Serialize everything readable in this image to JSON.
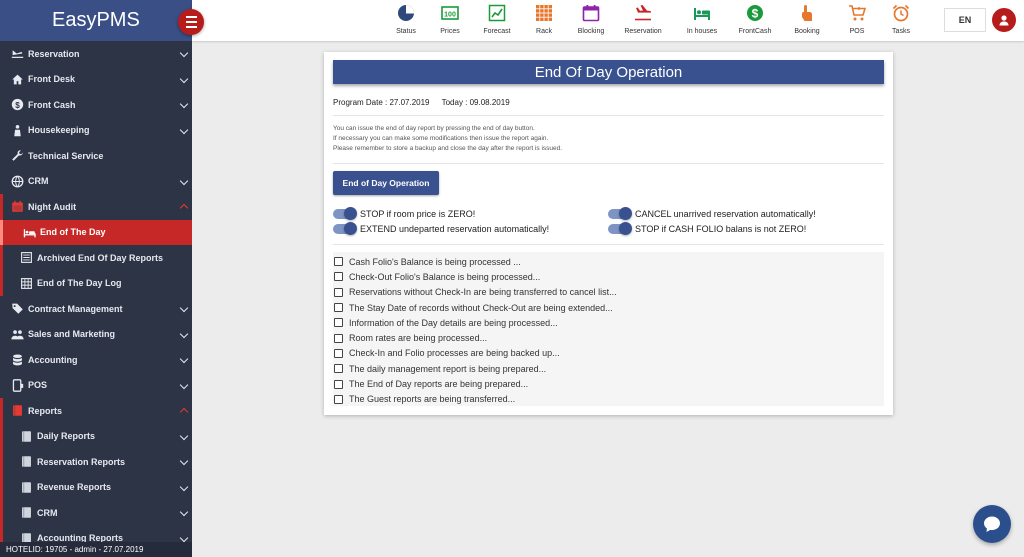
{
  "app": {
    "brand": "EasyPMS"
  },
  "sidebar": {
    "items": [
      {
        "label": "Reservation",
        "icon": "reservation-icon",
        "level": 0,
        "state": "collapsed"
      },
      {
        "label": "Front Desk",
        "icon": "home-icon",
        "level": 0,
        "state": "collapsed"
      },
      {
        "label": "Front Cash",
        "icon": "dollar-icon",
        "level": 0,
        "state": "collapsed"
      },
      {
        "label": "Housekeeping",
        "icon": "housekeeper-icon",
        "level": 0,
        "state": "collapsed"
      },
      {
        "label": "Technical Service",
        "icon": "wrench-icon",
        "level": 0,
        "state": "none"
      },
      {
        "label": "CRM",
        "icon": "globe-icon",
        "level": 0,
        "state": "collapsed"
      },
      {
        "label": "Night Audit",
        "icon": "calendar-icon",
        "level": 0,
        "state": "expanded"
      },
      {
        "label": "End of The Day",
        "icon": "bed-icon",
        "level": 1,
        "state": "active"
      },
      {
        "label": "Archived End Of Day Reports",
        "icon": "list-icon",
        "level": 1,
        "state": "none"
      },
      {
        "label": "End of The Day Log",
        "icon": "grid-icon",
        "level": 1,
        "state": "none"
      },
      {
        "label": "Contract Management",
        "icon": "tag-icon",
        "level": 0,
        "state": "collapsed"
      },
      {
        "label": "Sales and Marketing",
        "icon": "people-icon",
        "level": 0,
        "state": "collapsed"
      },
      {
        "label": "Accounting",
        "icon": "coins-icon",
        "level": 0,
        "state": "collapsed"
      },
      {
        "label": "POS",
        "icon": "pos-icon",
        "level": 0,
        "state": "collapsed"
      },
      {
        "label": "Reports",
        "icon": "book-icon",
        "level": 0,
        "state": "expanded"
      },
      {
        "label": "Daily Reports",
        "icon": "book-icon",
        "level": 1,
        "state": "collapsed"
      },
      {
        "label": "Reservation Reports",
        "icon": "book-icon",
        "level": 1,
        "state": "collapsed"
      },
      {
        "label": "Revenue Reports",
        "icon": "book-icon",
        "level": 1,
        "state": "collapsed"
      },
      {
        "label": "CRM",
        "icon": "book-icon",
        "level": 1,
        "state": "collapsed"
      },
      {
        "label": "Accounting Reports",
        "icon": "book-icon",
        "level": 1,
        "state": "collapsed"
      }
    ],
    "footer": "HOTELID: 19705 - admin - 27.07.2019"
  },
  "toolbar": [
    {
      "label": "Status",
      "icon": "pie-chart-icon",
      "color": "#2f4a7a"
    },
    {
      "label": "Prices",
      "icon": "price-100-icon",
      "color": "#1a9a3a"
    },
    {
      "label": "Forecast",
      "icon": "line-chart-icon",
      "color": "#1a9a3a"
    },
    {
      "label": "Rack",
      "icon": "rack-grid-icon",
      "color": "#e8772e"
    },
    {
      "label": "Blocking",
      "icon": "calendar-icon",
      "color": "#8e24aa"
    },
    {
      "label": "Reservation",
      "icon": "plane-landing-icon",
      "color": "#c62828"
    },
    {
      "label": "In houses",
      "icon": "bed-icon",
      "color": "#1a9a5a"
    },
    {
      "label": "FrontCash",
      "icon": "dollar-circle-icon",
      "color": "#1a9a3a"
    },
    {
      "label": "Booking",
      "icon": "hand-pointer-icon",
      "color": "#e8772e"
    },
    {
      "label": "POS",
      "icon": "cart-icon",
      "color": "#e8772e"
    },
    {
      "label": "Tasks",
      "icon": "alarm-clock-icon",
      "color": "#e8772e"
    }
  ],
  "language": "EN",
  "eod": {
    "title": "End Of Day Operation",
    "program_date": "Program Date : 27.07.2019",
    "today": "Today : 09.08.2019",
    "info": [
      "You can issue the end of day report by pressing the end of day button.",
      "If necessary you can make some modifications then issue the report again.",
      "Please remember to store a backup and close the day after the report is issued."
    ],
    "button": "End of Day Operation",
    "toggles": [
      {
        "label": "STOP if room price is ZERO!",
        "on": true
      },
      {
        "label": "CANCEL unarrived reservation automatically!",
        "on": true
      },
      {
        "label": "EXTEND undeparted reservation automatically!",
        "on": true
      },
      {
        "label": "STOP if CASH FOLIO balans is not ZERO!",
        "on": true
      }
    ],
    "steps": [
      "Cash Folio's Balance is being processed ...",
      "Check-Out Folio's Balance is being processed...",
      "Reservations without Check-In are being transferred to cancel list...",
      "The Stay Date of records without Check-Out are being extended...",
      "Information of the Day details are being processed...",
      "Room rates are being processed...",
      "Check-In and Folio processes are being backed up...",
      "The daily management report is being prepared...",
      "The End of Day reports are being prepared...",
      "The Guest reports are being transferred..."
    ]
  }
}
